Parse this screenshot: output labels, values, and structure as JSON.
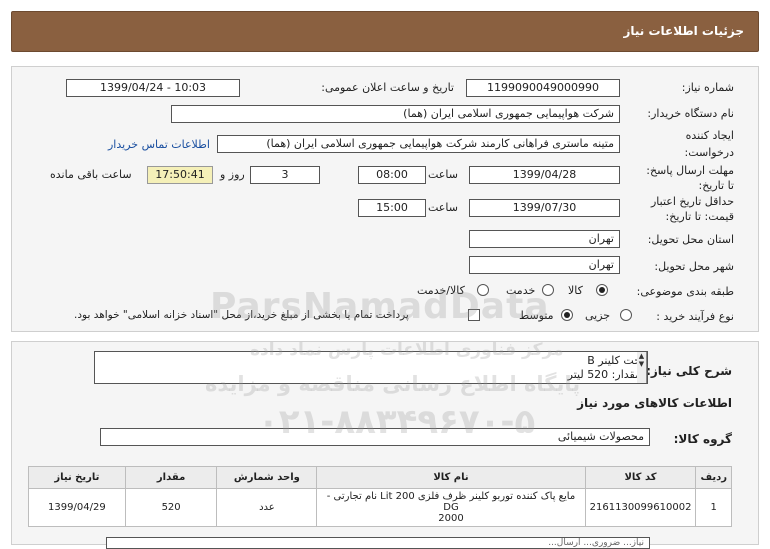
{
  "header": {
    "title": "جزئیات اطلاعات نیاز"
  },
  "form": {
    "need_number_label": "شماره نیاز:",
    "need_number": "1199090049000990",
    "announce_label": "تاریخ و ساعت اعلان عمومی:",
    "announce_value": "1399/04/24 - 10:03",
    "buyer_label": "نام دستگاه خریدار:",
    "buyer_value": "شرکت هواپیمایی جمهوری اسلامی ایران (هما)",
    "creator_label_1": "ایجاد کننده",
    "creator_label_2": "درخواست:",
    "creator_value": "متینه ماستری فراهانی کارمند شرکت هواپیمایی جمهوری اسلامی ایران (هما)",
    "contact_link": "اطلاعات تماس خریدار",
    "deadline_label_1": "مهلت ارسال پاسخ:",
    "deadline_label_2": "تا تاریخ:",
    "deadline_date": "1399/04/28",
    "time_label": "ساعت",
    "deadline_time": "08:00",
    "days_value": "3",
    "days_label": "روز و",
    "remaining_time": "17:50:41",
    "remaining_label": "ساعت باقی مانده",
    "validity_label_1": "حداقل تاریخ اعتبار",
    "validity_label_2": "قیمت: تا تاریخ:",
    "validity_date": "1399/07/30",
    "validity_time_label": "ساعت",
    "validity_time": "15:00",
    "province_label": "استان محل تحویل:",
    "province_value": "تهران",
    "city_label": "شهر محل تحویل:",
    "city_value": "تهران",
    "category_label": "طبقه بندی موضوعی:",
    "category_options": [
      "کالا",
      "خدمت",
      "کالا/خدمت"
    ],
    "category_selected": "کالا",
    "process_label": "نوع فرآیند خرید :",
    "process_options": [
      "جزیی",
      "متوسط"
    ],
    "process_selected": "متوسط",
    "payment_note": "پرداخت تمام یا بخشی از مبلغ خرید،از محل \"اسناد خزانه اسلامی\" خواهد بود."
  },
  "description": {
    "label": "شرح کلی نیاز:",
    "line1": "جت کلینر B",
    "line2": "مقدار: 520 لیتر"
  },
  "goods": {
    "section_title": "اطلاعات کالاهای مورد نیاز",
    "group_label": "گروه کالا:",
    "group_value": "محصولات شیمیائی",
    "columns": [
      "ردیف",
      "کد کالا",
      "نام کالا",
      "واحد شمارش",
      "مقدار",
      "تاریخ نیاز"
    ],
    "rows": [
      {
        "row": "1",
        "code": "2161130099610002",
        "name_line1": "مایع پاک کننده توربو کلینر ظرف فلزی Lit 200 نام تجارتی -DG",
        "name_line2": "2000",
        "unit": "عدد",
        "qty": "520",
        "date": "1399/04/29"
      }
    ]
  },
  "footer_partial": "نیاز... ضروری... ارسال...",
  "watermark": {
    "brand": "ParsNamadData",
    "line1": "مرکز فناوری اطلاعات پارس نماد داده",
    "line2": "پایگاه اطلاع رسانی مناقصه و مزایده",
    "phone": "۰۲۱-۸۸۳۴۹۶۷۰-۵"
  }
}
